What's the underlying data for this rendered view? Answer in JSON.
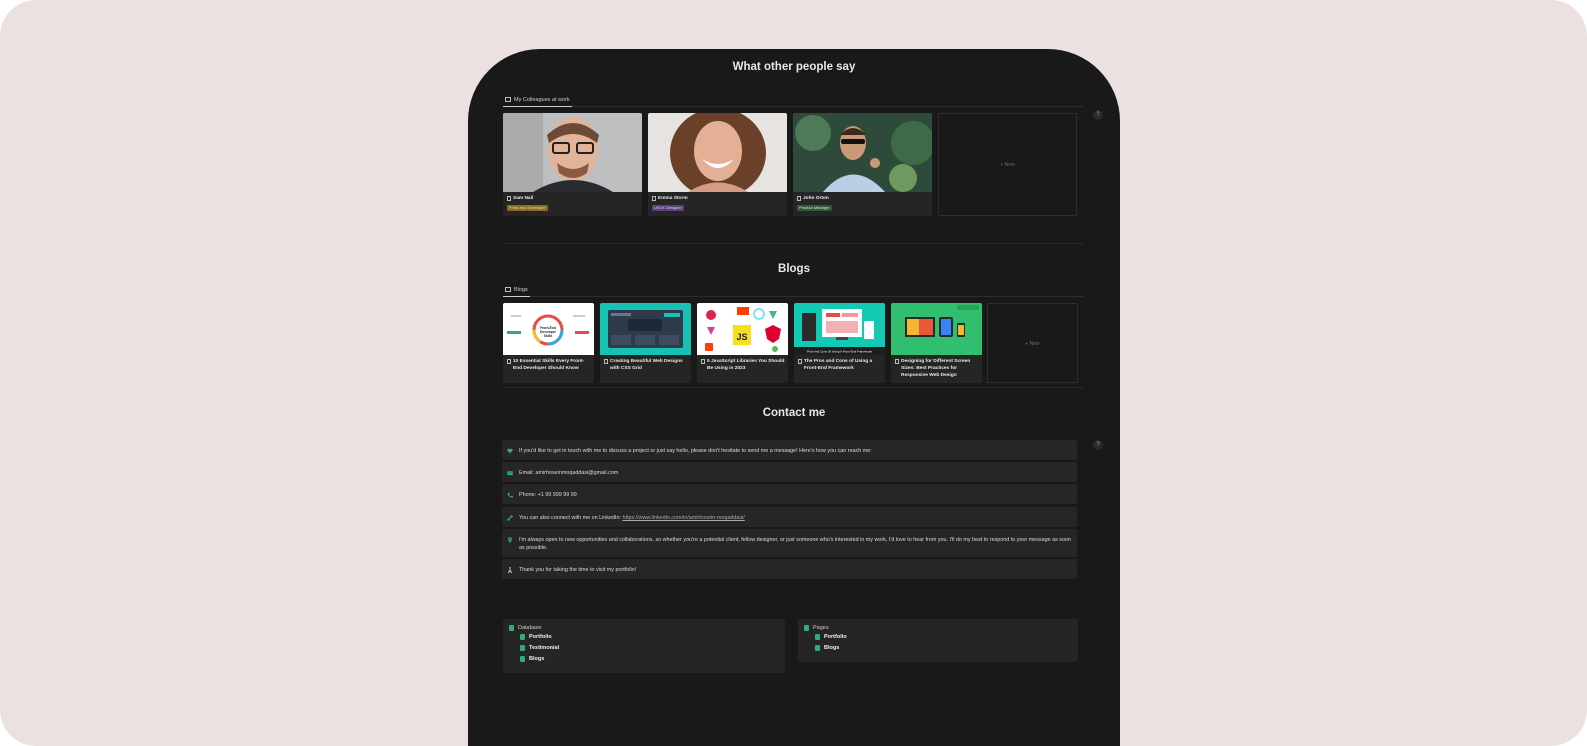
{
  "testimonials": {
    "title": "What other people say",
    "tab": "My Colleagues at work",
    "new_label": "+ New",
    "people": [
      {
        "name": "Sam Nail",
        "role": "Front-end Developer",
        "badge_color": "#8a6a2a"
      },
      {
        "name": "Emma Storm",
        "role": "UI/UX Designer",
        "badge_color": "#5b3f7a"
      },
      {
        "name": "John Orton",
        "role": "Product Manager",
        "badge_color": "#2e5a3a"
      }
    ]
  },
  "blogs": {
    "title": "Blogs",
    "tab": "Blogs",
    "new_label": "+ New",
    "posts": [
      {
        "title": "10 Essential Skills Every Front-End Developer Should Know",
        "cover": "Front-End Developer Skills"
      },
      {
        "title": "Creating Beautiful Web Designs with CSS Grid",
        "cover": ""
      },
      {
        "title": "5 JavaScript Libraries You Should Be Using in 2023",
        "cover": "JS"
      },
      {
        "title": "The Pros and Cons of Using a Front-End Framework",
        "cover": "Pros And Cons Of Using A Front-End Framework"
      },
      {
        "title": "Designing for Different Screen Sizes: Best Practices for Responsive Web Design",
        "cover": ""
      }
    ]
  },
  "contact": {
    "title": "Contact me",
    "items": [
      {
        "icon": "heart-icon",
        "text": "If you'd like to get in touch with me to discuss a project or just say hello, please don't hesitate to send me a message! Here's how you can reach me:"
      },
      {
        "icon": "mail-icon",
        "text": "Email: amirhoseinmoqaddasi@gmail.com"
      },
      {
        "icon": "phone-icon",
        "text": "Phone: +1 99 999 99 99"
      },
      {
        "icon": "link-icon",
        "text": "You can also connect with me on LinkedIn: ",
        "link": "https://www.linkedin.com/in/amirhosein-moqaddasi/"
      },
      {
        "icon": "pin-icon",
        "text": "I'm always open to new opportunities and collaborations, so whether you're a potential client, fellow designer, or just someone who's interested in my work, I'd love to hear from you. I'll do my best to respond to your message as soon as possible."
      },
      {
        "icon": "person-icon",
        "text": "Thank you for taking the time to visit my portfolio!"
      }
    ]
  },
  "footer": {
    "database": {
      "label": "Database",
      "items": [
        "Portfolio",
        "Testimonial",
        "Blogs"
      ]
    },
    "pages": {
      "label": "Pages",
      "items": [
        "Portfolio",
        "Blogs"
      ]
    }
  },
  "help_label": "?",
  "colors": {
    "background": "#ebe1e1",
    "device": "#191919",
    "accent": "#2fae73"
  }
}
